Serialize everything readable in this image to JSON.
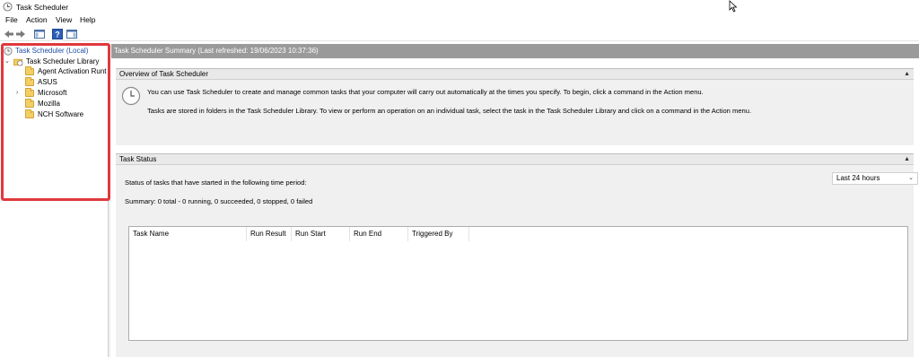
{
  "window": {
    "title": "Task Scheduler"
  },
  "menu": [
    "File",
    "Action",
    "View",
    "Help"
  ],
  "tree": {
    "root": "Task Scheduler (Local)",
    "library": "Task Scheduler Library",
    "folders": [
      "Agent Activation Runt",
      "ASUS",
      "Microsoft",
      "Mozilla",
      "NCH Software"
    ]
  },
  "main": {
    "header": "Task Scheduler Summary (Last refreshed: 19/06/2023 10:37:36)",
    "overview": {
      "title": "Overview of Task Scheduler",
      "line1": "You can use Task Scheduler to create and manage common tasks that your computer will carry out automatically at the times you specify. To begin, click a command in the Action menu.",
      "line2": "Tasks are stored in folders in the Task Scheduler Library. To view or perform an operation on an individual task, select the task in the Task Scheduler Library and click on a command in the Action menu."
    },
    "status": {
      "title": "Task Status",
      "period_label": "Status of tasks that have started in the following time period:",
      "period_value": "Last 24 hours",
      "summary": "Summary: 0 total - 0 running, 0 succeeded, 0 stopped, 0 failed",
      "columns": [
        "Task Name",
        "Run Result",
        "Run Start",
        "Run End",
        "Triggered By"
      ]
    }
  },
  "colors": {
    "highlight": "#e0393d",
    "header_bg": "#9a9a9a",
    "section_bg": "#f0f0f0"
  },
  "icons": [
    "task-scheduler-icon",
    "back-arrow-icon",
    "forward-arrow-icon",
    "console-tree-icon",
    "help-icon",
    "action-pane-icon",
    "folder-icon",
    "cursor-icon"
  ]
}
